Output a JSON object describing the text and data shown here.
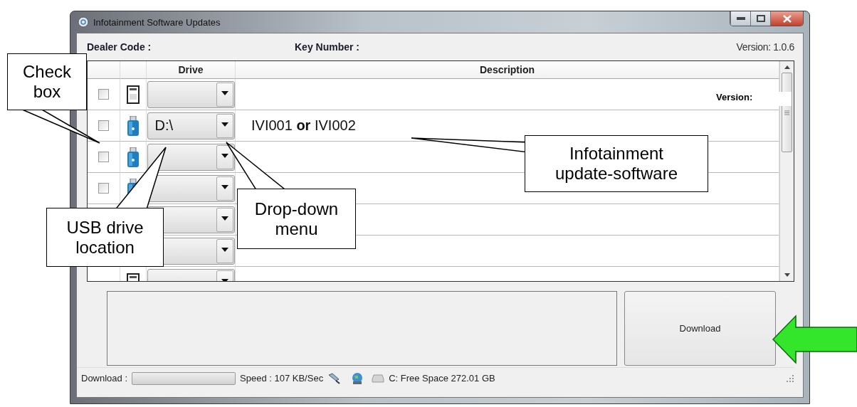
{
  "window": {
    "title": "Infotainment Software Updates"
  },
  "header": {
    "dealer_code_label": "Dealer Code :",
    "key_number_label": "Key Number :",
    "version": "Version: 1.0.6"
  },
  "table": {
    "columns": [
      {
        "label": "Drive"
      },
      {
        "label": "Description"
      }
    ],
    "version_label": "Version:",
    "rows": [
      {
        "kind": "sd_card",
        "checked": false
      },
      {
        "kind": "usb_drive",
        "checked": false,
        "drive": "D:\\",
        "description": "IVI001 **or**  IVI002"
      },
      {
        "kind": "usb_drive",
        "checked": false
      },
      {
        "kind": "usb_drive",
        "checked": false
      },
      {},
      {},
      {
        "kind": "sd_card"
      }
    ]
  },
  "download_button": "Download",
  "status_bar": {
    "download_label": "Download :",
    "progress": {
      "level": 0
    },
    "speed": "Speed :  107 KB/Sec",
    "free_space": "C: Free Space 272.01 GB"
  },
  "annotations": [
    {
      "kind": "callout",
      "text": "Check box"
    },
    {
      "kind": "callout",
      "text": "USB drive location"
    },
    {
      "kind": "callout",
      "text": "Drop-down menu"
    },
    {
      "kind": "callout",
      "text": "Infotainment update-software"
    }
  ]
}
